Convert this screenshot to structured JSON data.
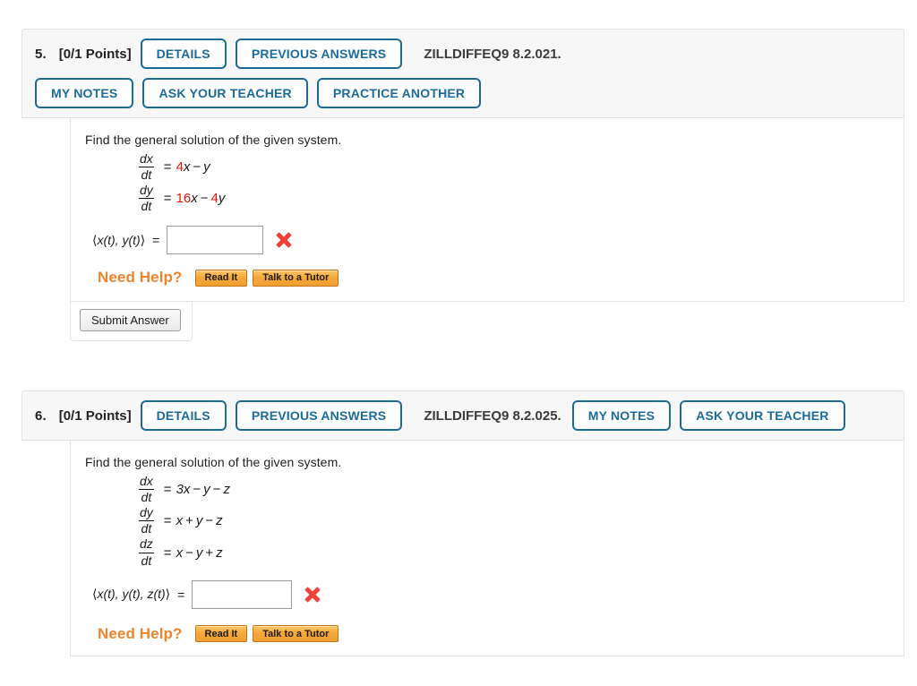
{
  "problems": [
    {
      "number": "5.",
      "points": "[0/1 Points]",
      "id_label": "ZILLDIFFEQ9 8.2.021.",
      "buttons_row1": [
        "DETAILS",
        "PREVIOUS ANSWERS"
      ],
      "buttons_row2": [
        "MY NOTES",
        "ASK YOUR TEACHER",
        "PRACTICE ANOTHER"
      ],
      "prompt": "Find the general solution of the given system.",
      "equations": [
        {
          "numerator": "dx",
          "denominator": "dt",
          "equals": "=",
          "terms": [
            {
              "text": "4",
              "style": "red"
            },
            {
              "text": "x",
              "style": "var"
            },
            {
              "text": "−",
              "style": "op"
            },
            {
              "text": "y",
              "style": "var"
            }
          ]
        },
        {
          "numerator": "dy",
          "denominator": "dt",
          "equals": "=",
          "terms": [
            {
              "text": "16",
              "style": "red"
            },
            {
              "text": "x",
              "style": "var"
            },
            {
              "text": "−",
              "style": "op"
            },
            {
              "text": "4",
              "style": "red"
            },
            {
              "text": "y",
              "style": "var"
            }
          ]
        }
      ],
      "answer_label_open": "⟨",
      "answer_label_body": "x(t), y(t)",
      "answer_label_close": "⟩",
      "answer_equals": "=",
      "answer_value": "",
      "answer_placeholder": "",
      "answer_status": "incorrect",
      "need_help_label": "Need Help?",
      "help_buttons": [
        "Read It",
        "Talk to a Tutor"
      ],
      "submit_label": "Submit Answer",
      "has_submit": true
    },
    {
      "number": "6.",
      "points": "[0/1 Points]",
      "id_label": "ZILLDIFFEQ9 8.2.025.",
      "buttons_row1": [
        "DETAILS",
        "PREVIOUS ANSWERS"
      ],
      "buttons_row1_tail": [
        "MY NOTES",
        "ASK YOUR TEACHER"
      ],
      "prompt": "Find the general solution of the given system.",
      "equations": [
        {
          "numerator": "dx",
          "denominator": "dt",
          "equals": "=",
          "terms": [
            {
              "text": "3",
              "style": "plain"
            },
            {
              "text": "x",
              "style": "var"
            },
            {
              "text": "−",
              "style": "op"
            },
            {
              "text": "y",
              "style": "var"
            },
            {
              "text": "−",
              "style": "op"
            },
            {
              "text": "z",
              "style": "var"
            }
          ]
        },
        {
          "numerator": "dy",
          "denominator": "dt",
          "equals": "=",
          "terms": [
            {
              "text": "x",
              "style": "var"
            },
            {
              "text": "+",
              "style": "op"
            },
            {
              "text": "y",
              "style": "var"
            },
            {
              "text": "−",
              "style": "op"
            },
            {
              "text": "z",
              "style": "var"
            }
          ]
        },
        {
          "numerator": "dz",
          "denominator": "dt",
          "equals": "=",
          "terms": [
            {
              "text": "x",
              "style": "var"
            },
            {
              "text": "−",
              "style": "op"
            },
            {
              "text": "y",
              "style": "var"
            },
            {
              "text": "+",
              "style": "op"
            },
            {
              "text": "z",
              "style": "var"
            }
          ]
        }
      ],
      "answer_label_open": "⟨",
      "answer_label_body": "x(t), y(t), z(t)",
      "answer_label_close": "⟩",
      "answer_equals": "=",
      "answer_value": "",
      "answer_placeholder": "",
      "answer_status": "incorrect",
      "need_help_label": "Need Help?",
      "help_buttons": [
        "Read It",
        "Talk to a Tutor"
      ],
      "has_submit": false
    }
  ],
  "colors": {
    "pill_blue": "#1a6b9c",
    "red_coefficient": "#e8140c",
    "need_help_orange": "#f0842a",
    "help_button_orange": "#f5a93b",
    "wrong_mark_red": "#f0403a",
    "header_band": "#f7f7f7"
  }
}
